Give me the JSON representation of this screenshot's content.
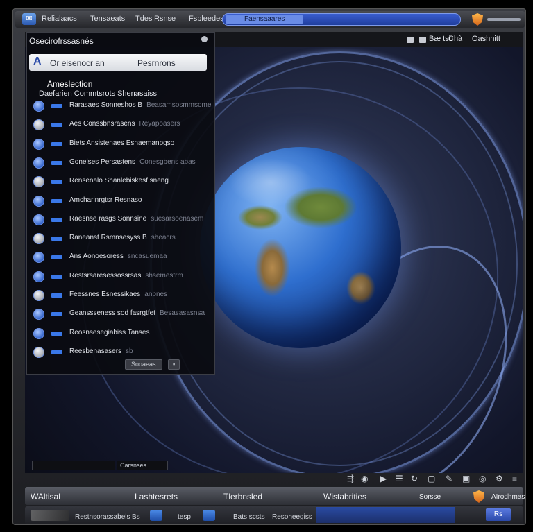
{
  "window": {
    "menus": [
      "Relialaacs",
      "Tensaeats",
      "Tdes",
      "Rsnse",
      "Fsbleedes"
    ],
    "search_tag": "Faensaaares"
  },
  "toolbar": {
    "panel_title": "Osecirofrssasnés",
    "right": [
      "Bæ tsb",
      "Chà",
      "Oashhitt"
    ]
  },
  "panel": {
    "search_letter": "A",
    "search_left": "Or eisenocr an",
    "search_right": "Pesrnrons",
    "section_heading": "Ameslection",
    "section_sub": "Daefarien Commtsrots Shenasaiss",
    "rows": [
      {
        "label": "Rarasaes Sonneshos B",
        "extra": "Beasamsosmmsome"
      },
      {
        "label": "Aes Conssbnsrasens",
        "extra": "Reyapoasers"
      },
      {
        "label": "Biets Ansistenaes Esnaemanpgso",
        "extra": ""
      },
      {
        "label": "Gonelses Persastens",
        "extra": "Conesgbens abas"
      },
      {
        "label": "Rensenalo Shanlebiskesf sneng",
        "extra": ""
      },
      {
        "label": "Amcharinrgtsr Resnaso",
        "extra": ""
      },
      {
        "label": "Raesnse rasgs Sonnsine",
        "extra": "suesarsoenasem"
      },
      {
        "label": "Raneanst Rsmnsesyss B",
        "extra": "sheacrs"
      },
      {
        "label": "Ans Aonoesoress",
        "extra": "sncasuemaa"
      },
      {
        "label": "Restsrsaresessossrsas",
        "extra": "shsemestrm"
      },
      {
        "label": "Feessnes Esnessikaes",
        "extra": "anbnes"
      },
      {
        "label": "Geanssseness sod fasrgtfet",
        "extra": "Besasasasnsa"
      },
      {
        "label": "Reosnsesegiabiss Tanses",
        "extra": ""
      },
      {
        "label": "Reesbenasasers",
        "extra": "sb"
      }
    ],
    "footer_button": "Sooaeas"
  },
  "lower_field": "Carsnses",
  "status1": [
    "WAltisal",
    "Lashtesrets",
    "Tlerbnsled",
    "Wistabrities",
    "Sorsse",
    "Aïrodhmas"
  ],
  "status2": [
    "Restnsorassabels",
    "Bs",
    "tesp",
    "Bats scsts",
    "Resoheegiss"
  ],
  "status2_button": "Rs",
  "colors": {
    "accent": "#3a78e8",
    "shield": "#e2802a",
    "panel": "#0a0b10"
  }
}
